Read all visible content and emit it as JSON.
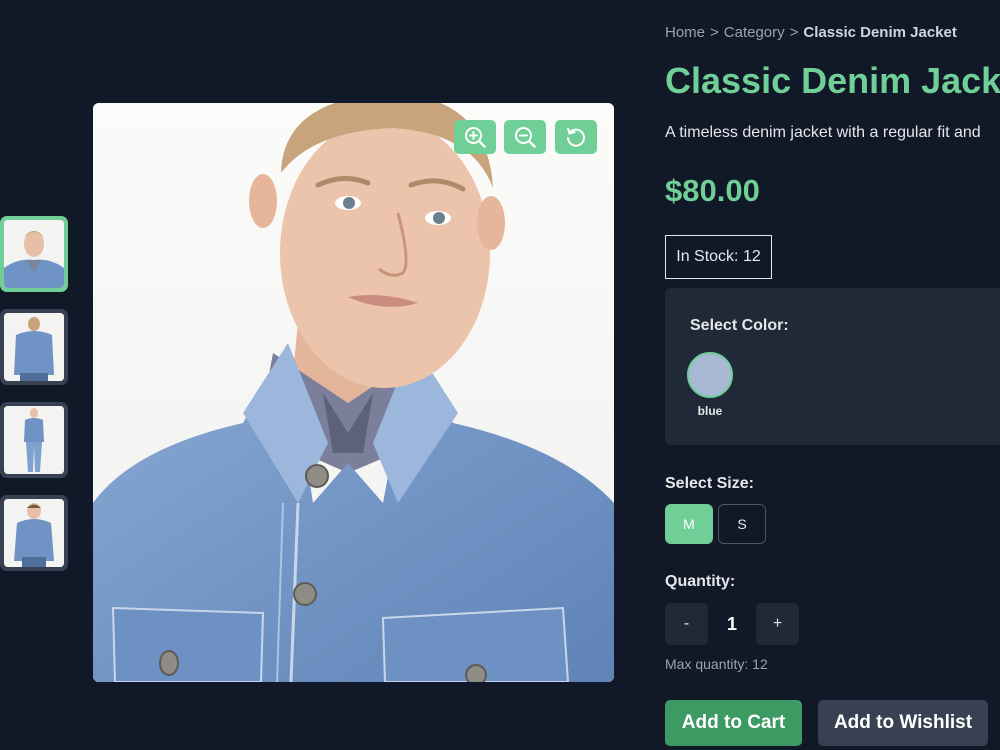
{
  "breadcrumb": {
    "home": "Home",
    "category": "Category",
    "separator": ">",
    "current": "Classic Denim Jacket"
  },
  "product": {
    "title": "Classic Denim Jacket",
    "description": "A timeless denim jacket with a regular fit and",
    "price": "$80.00",
    "stock_text": "In Stock: 12"
  },
  "gallery": {
    "thumbnails": [
      {
        "icon": "thumbnail-closeup",
        "active": true
      },
      {
        "icon": "thumbnail-back-view",
        "active": false
      },
      {
        "icon": "thumbnail-full-body",
        "active": false
      },
      {
        "icon": "thumbnail-standing",
        "active": false
      }
    ],
    "controls": [
      {
        "icon": "zoom-in-icon"
      },
      {
        "icon": "zoom-out-icon"
      },
      {
        "icon": "reset-rotate-icon"
      }
    ]
  },
  "color": {
    "label": "Select Color:",
    "options": [
      {
        "name": "blue",
        "swatch": "#a9b8d4",
        "selected": true
      }
    ]
  },
  "size": {
    "label": "Select Size:",
    "options": [
      {
        "label": "M",
        "selected": true
      },
      {
        "label": "S",
        "selected": false
      }
    ]
  },
  "quantity": {
    "label": "Quantity:",
    "minus": "-",
    "value": "1",
    "plus": "+",
    "max_text": "Max quantity: 12"
  },
  "actions": {
    "add_to_cart": "Add to Cart",
    "add_to_wishlist": "Add to Wishlist"
  },
  "colors": {
    "background": "#111827",
    "accent": "#6fcf97",
    "accent_dark": "#3c9a63",
    "panel": "#1f2937"
  }
}
